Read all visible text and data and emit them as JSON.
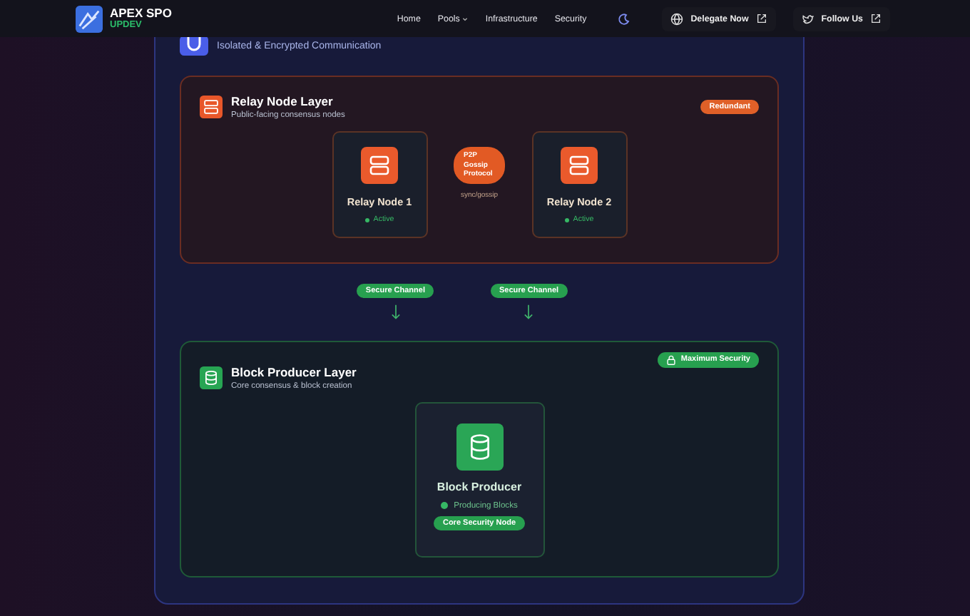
{
  "header": {
    "brand": "APEX SPO",
    "tagline": "UPDEV",
    "nav": [
      {
        "label": "Home",
        "dropdown": false
      },
      {
        "label": "Pools",
        "dropdown": true
      },
      {
        "label": "Infrastructure",
        "dropdown": false
      },
      {
        "label": "Security",
        "dropdown": false
      }
    ],
    "delegate": "Delegate Now",
    "follow": "Follow Us"
  },
  "network": {
    "subtitle": "Isolated & Encrypted Communication"
  },
  "relay_layer": {
    "title": "Relay Node Layer",
    "subtitle": "Public-facing consensus nodes",
    "badge": "Redundant",
    "nodes": [
      {
        "name": "Relay Node 1",
        "status": "Active"
      },
      {
        "name": "Relay Node 2",
        "status": "Active"
      }
    ],
    "link_bubble": "P2P Gossip Protocol",
    "link_label": "sync/gossip"
  },
  "channels": [
    "Secure Channel",
    "Secure Channel"
  ],
  "producer_layer": {
    "title": "Block Producer Layer",
    "subtitle": "Core consensus & block creation",
    "badge": "Maximum Security",
    "node": {
      "name": "Block Producer",
      "status": "Producing Blocks",
      "tag": "Core Security Node"
    }
  }
}
